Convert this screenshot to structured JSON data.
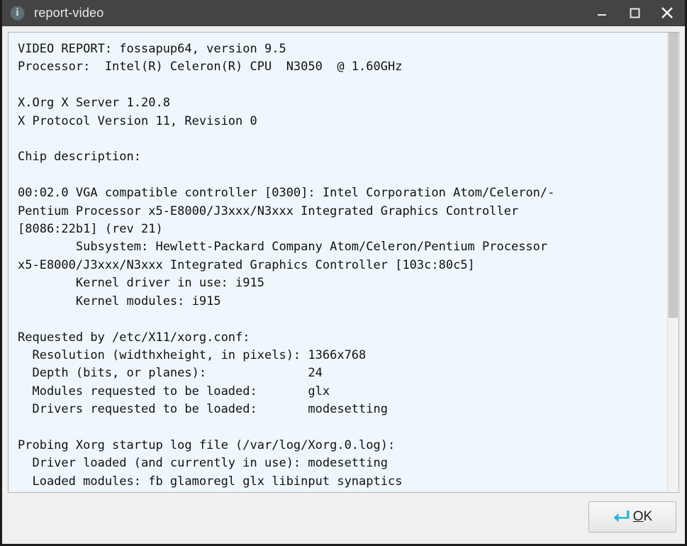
{
  "window": {
    "title": "report-video",
    "icon": "info-icon",
    "titlebar_color": "#444444",
    "controls": [
      {
        "name": "minimize",
        "glyph": "minimize-icon"
      },
      {
        "name": "maximize",
        "glyph": "maximize-icon"
      },
      {
        "name": "close",
        "glyph": "close-icon"
      }
    ]
  },
  "textview": {
    "background_color": "#eff7fc",
    "scrollbar": {
      "visible": true,
      "thumb_position": "top",
      "thumb_fraction": 0.62
    },
    "report_lines": [
      "VIDEO REPORT: fossapup64, version 9.5",
      "Processor:  Intel(R) Celeron(R) CPU  N3050  @ 1.60GHz",
      "",
      "X.Org X Server 1.20.8",
      "X Protocol Version 11, Revision 0",
      "",
      "Chip description:",
      "",
      "00:02.0 VGA compatible controller [0300]: Intel Corporation Atom/Celeron/-",
      "Pentium Processor x5-E8000/J3xxx/N3xxx Integrated Graphics Controller",
      "[8086:22b1] (rev 21)",
      "        Subsystem: Hewlett-Packard Company Atom/Celeron/Pentium Processor",
      "x5-E8000/J3xxx/N3xxx Integrated Graphics Controller [103c:80c5]",
      "        Kernel driver in use: i915",
      "        Kernel modules: i915",
      "",
      "Requested by /etc/X11/xorg.conf:",
      "  Resolution (widthxheight, in pixels): 1366x768",
      "  Depth (bits, or planes):              24",
      "  Modules requested to be loaded:       glx",
      "  Drivers requested to be loaded:       modesetting",
      "",
      "Probing Xorg startup log file (/var/log/Xorg.0.log):",
      "  Driver loaded (and currently in use): modesetting",
      "  Loaded modules: fb glamoregl glx libinput synaptics"
    ],
    "report_details": {
      "header": "VIDEO REPORT",
      "distro": "fossapup64",
      "version": "9.5",
      "processor": "Intel(R) Celeron(R) CPU  N3050  @ 1.60GHz",
      "xorg_server_version": "1.20.8",
      "x_protocol_version": "11",
      "x_protocol_revision": "0",
      "chip_description_label": "Chip description:",
      "pci_slot": "00:02.0",
      "pci_class": "VGA compatible controller [0300]",
      "pci_device": "Intel Corporation Atom/Celeron/-Pentium Processor x5-E8000/J3xxx/N3xxx Integrated Graphics Controller",
      "pci_id": "[8086:22b1]",
      "pci_rev": "(rev 21)",
      "subsystem": "Hewlett-Packard Company Atom/Celeron/Pentium Processor x5-E8000/J3xxx/N3xxx Integrated Graphics Controller [103c:80c5]",
      "kernel_driver_in_use": "i915",
      "kernel_modules": "i915",
      "requested_by_file": "/etc/X11/xorg.conf",
      "requested": [
        {
          "label": "Resolution (widthxheight, in pixels):",
          "value": "1366x768"
        },
        {
          "label": "Depth (bits, or planes):",
          "value": "24"
        },
        {
          "label": "Modules requested to be loaded:",
          "value": "glx"
        },
        {
          "label": "Drivers requested to be loaded:",
          "value": "modesetting"
        }
      ],
      "probing_log_file": "/var/log/Xorg.0.log",
      "driver_loaded_in_use": "modesetting",
      "loaded_modules": "fb glamoregl glx libinput synaptics"
    }
  },
  "actions": {
    "ok": {
      "label_prefix": "",
      "label_underlined": "O",
      "label_suffix": "K",
      "icon": "return-arrow-icon",
      "icon_color": "#29b6e0"
    }
  }
}
